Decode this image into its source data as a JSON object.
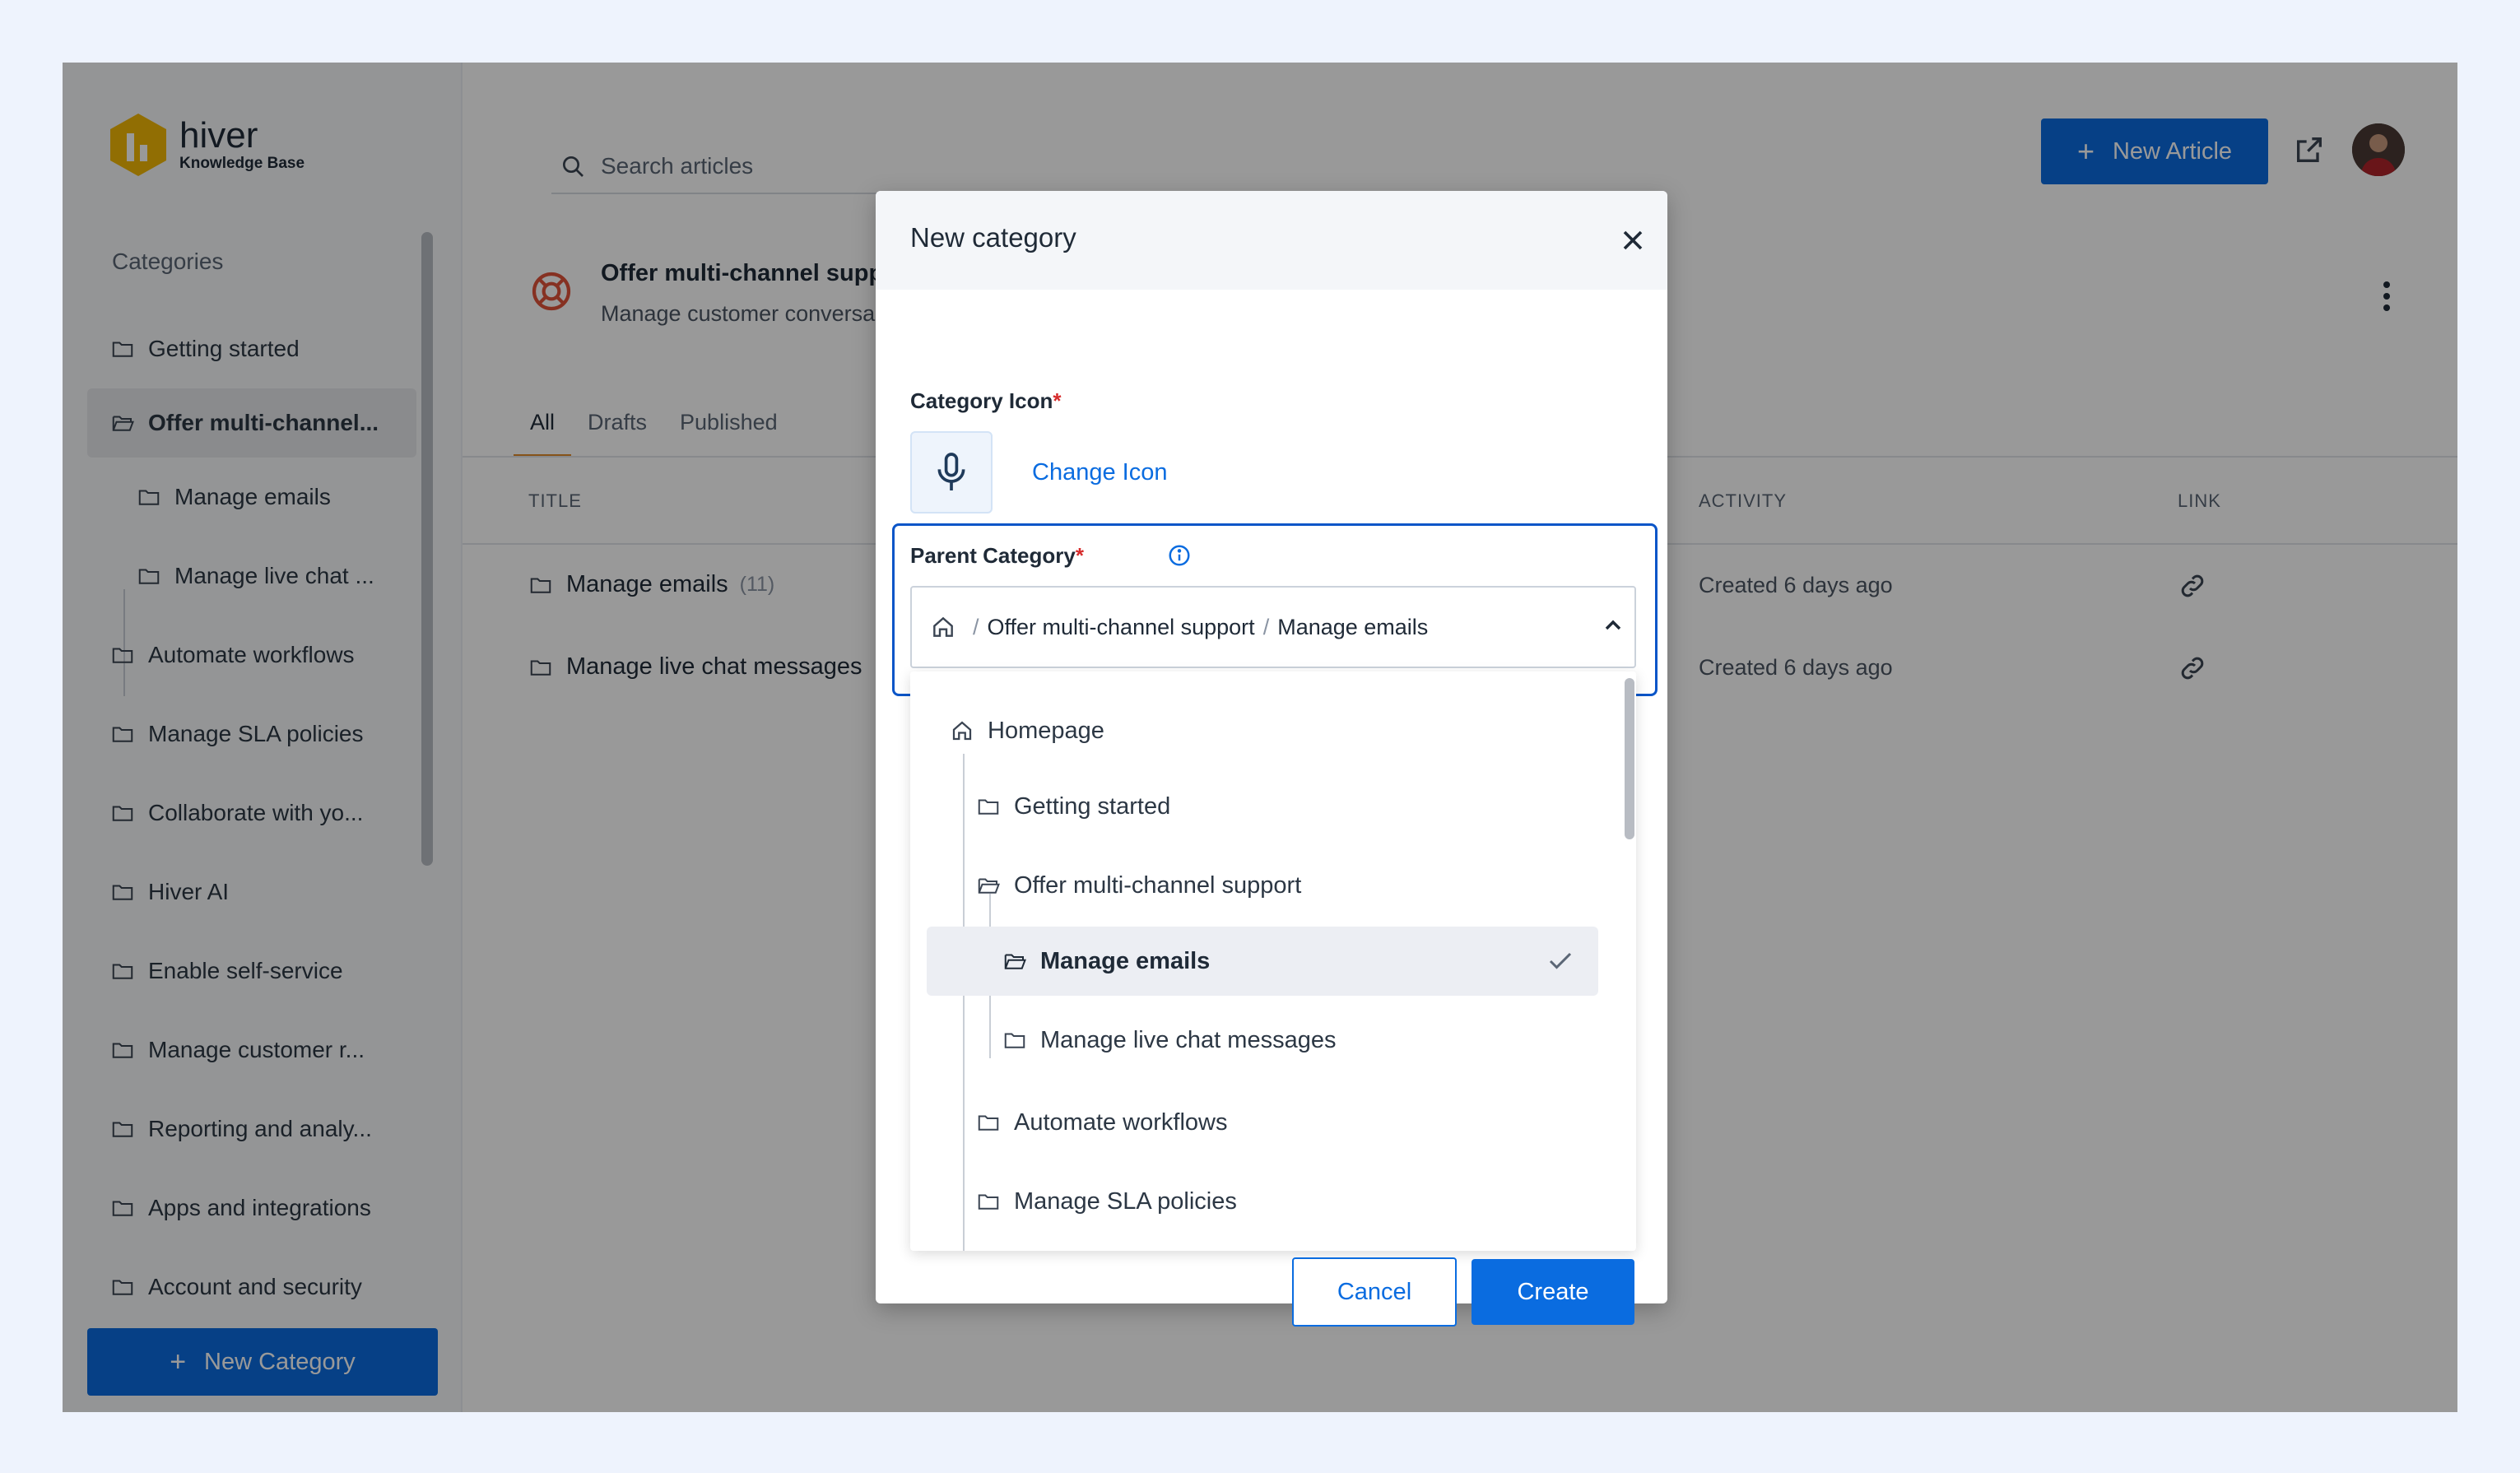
{
  "brand": {
    "name": "hiver",
    "subtitle": "Knowledge Base"
  },
  "sidebar": {
    "heading": "Categories",
    "items": [
      {
        "label": "Getting started"
      },
      {
        "label": "Offer multi-channel..."
      },
      {
        "label": "Manage emails"
      },
      {
        "label": "Manage live chat ..."
      },
      {
        "label": "Automate workflows"
      },
      {
        "label": "Manage SLA policies"
      },
      {
        "label": "Collaborate with yo..."
      },
      {
        "label": "Hiver AI"
      },
      {
        "label": "Enable self-service"
      },
      {
        "label": "Manage customer r..."
      },
      {
        "label": "Reporting and analy..."
      },
      {
        "label": "Apps and integrations"
      },
      {
        "label": "Account and security"
      }
    ],
    "new_category_label": "New Category"
  },
  "header": {
    "search_placeholder": "Search articles",
    "new_article_label": "New Article"
  },
  "category": {
    "title": "Offer multi-channel supp",
    "description": "Manage customer conversa"
  },
  "tabs": [
    {
      "label": "All"
    },
    {
      "label": "Drafts"
    },
    {
      "label": "Published"
    }
  ],
  "table": {
    "columns": {
      "title": "TITLE",
      "activity": "ACTIVITY",
      "link": "LINK"
    },
    "rows": [
      {
        "title": "Manage emails",
        "count": "(11)",
        "activity": "Created 6 days ago"
      },
      {
        "title": "Manage live chat messages",
        "count": "",
        "activity": "Created 6 days ago"
      }
    ]
  },
  "modal": {
    "title": "New category",
    "icon_label": "Category Icon",
    "change_icon_label": "Change Icon",
    "parent_label": "Parent Category",
    "required_mark": "*",
    "breadcrumb": {
      "sep": "/",
      "level1": "Offer multi-channel support",
      "level2": "Manage emails"
    },
    "options": [
      {
        "label": "Homepage"
      },
      {
        "label": "Getting started"
      },
      {
        "label": "Offer multi-channel support"
      },
      {
        "label": "Manage emails"
      },
      {
        "label": "Manage live chat messages"
      },
      {
        "label": "Automate workflows"
      },
      {
        "label": "Manage SLA policies"
      }
    ],
    "cancel_label": "Cancel",
    "create_label": "Create"
  },
  "colors": {
    "primary": "#0a6ce0",
    "required": "#d62c2c",
    "brand_yellow": "#f2b705",
    "tab_accent": "#e08a2a",
    "lifebuoy": "#e0533a"
  }
}
